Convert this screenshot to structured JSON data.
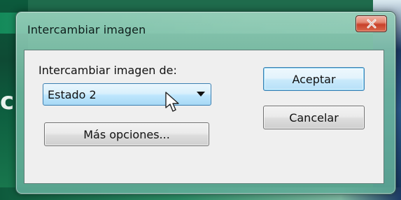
{
  "window": {
    "title": "Intercambiar imagen",
    "close_icon": "close-x-icon"
  },
  "form": {
    "label": "Intercambiar imagen de:",
    "select": {
      "selected": "Estado 2",
      "arrow_icon": "dropdown-arrow-icon"
    },
    "more_options_label": "Más opciones..."
  },
  "actions": {
    "accept_label": "Aceptar",
    "cancel_label": "Cancelar"
  },
  "background": {
    "partial_letter": "c"
  },
  "colors": {
    "frame": "#6fb9a0",
    "default_button_border": "#3c7fb1",
    "close_button": "#c8412a",
    "client_area": "#efefef"
  },
  "pointer": "arrow-cursor-icon"
}
